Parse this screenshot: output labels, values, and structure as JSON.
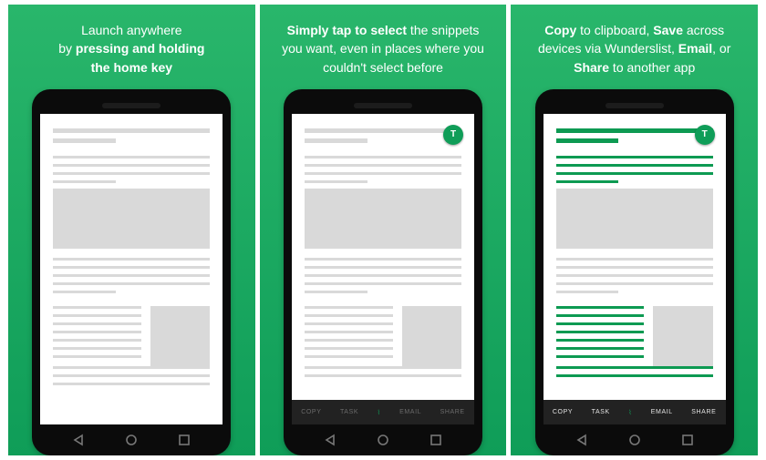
{
  "panels": [
    {
      "html": "Launch anywhere<br>by <b>pressing and holding<br>the home key</b>"
    },
    {
      "html": "<b>Simply tap to select</b> the snippets you want, even in places where you couldn't select before"
    },
    {
      "html": "<b>Copy</b> to clipboard, <b>Save</b> across devices via Wunderslist, <b>Email</b>, or <b>Share</b> to another app"
    }
  ],
  "badge": "T",
  "toolbar": {
    "copy": "COPY",
    "task": "TASK",
    "email": "EMAIL",
    "share": "SHARE"
  }
}
